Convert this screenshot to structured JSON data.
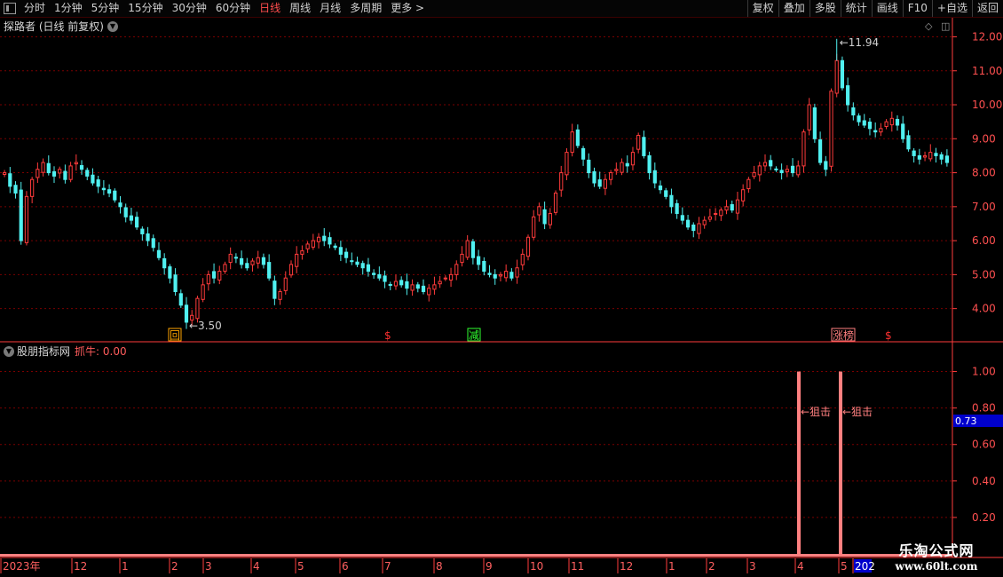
{
  "toolbar": {
    "periods": [
      "分时",
      "1分钟",
      "5分钟",
      "15分钟",
      "30分钟",
      "60分钟",
      "日线",
      "周线",
      "月线",
      "多周期",
      "更多 >"
    ],
    "active_period": "日线",
    "right": [
      "复权",
      "叠加",
      "多股",
      "统计",
      "画线",
      "F10",
      "+自选",
      "返回"
    ]
  },
  "main_chart": {
    "title": "探路者 (日线 前复权)",
    "high_label": "11.94",
    "low_label": "3.50",
    "markers": [
      "回",
      "$",
      "减",
      "涨榜",
      "$"
    ]
  },
  "indicator": {
    "name": "股朋指标网",
    "value_label": "抓牛: 0.00",
    "current_value_badge": "0.73",
    "signal_label": "狙击"
  },
  "watermark": {
    "line1": "乐淘公式网",
    "line2": "www.60lt.com"
  },
  "colors": {
    "up": "#ff3b3b",
    "down": "#50f0f0",
    "grid": "#7a0000",
    "axis": "#ff3b3b",
    "signal": "#ff8080",
    "badge": "#0000cc"
  },
  "chart_data": [
    {
      "type": "candlestick",
      "title": "探路者 (日线 前复权)",
      "y_ticks": [
        4.0,
        5.0,
        6.0,
        7.0,
        8.0,
        9.0,
        10.0,
        11.0,
        12.0
      ],
      "ylim": [
        3.05,
        12.3
      ],
      "x_labels": [
        "2023年",
        "12",
        "1",
        "2",
        "3",
        "4",
        "5",
        "6",
        "7",
        "8",
        "9",
        "10",
        "11",
        "12",
        "1",
        "2",
        "3",
        "4",
        "5",
        "202"
      ],
      "annotations": [
        {
          "text": "11.94",
          "type": "high"
        },
        {
          "text": "3.50",
          "type": "low"
        }
      ],
      "close_series": [
        8.0,
        7.6,
        7.4,
        6.0,
        7.3,
        7.8,
        8.1,
        8.3,
        8.0,
        7.9,
        8.1,
        7.8,
        8.2,
        8.3,
        8.1,
        7.9,
        7.7,
        7.6,
        7.5,
        7.4,
        7.2,
        7.0,
        6.7,
        6.6,
        6.4,
        6.2,
        6.0,
        5.8,
        5.5,
        5.2,
        4.9,
        4.5,
        4.1,
        3.6,
        3.8,
        4.3,
        4.7,
        5.0,
        4.9,
        5.1,
        5.3,
        5.6,
        5.5,
        5.3,
        5.2,
        5.4,
        5.5,
        5.3,
        4.9,
        4.3,
        4.5,
        4.9,
        5.3,
        5.6,
        5.7,
        5.9,
        6.0,
        6.1,
        6.0,
        5.9,
        5.8,
        5.6,
        5.5,
        5.4,
        5.3,
        5.2,
        5.1,
        5.0,
        4.9,
        4.8,
        4.7,
        4.8,
        4.7,
        4.6,
        4.7,
        4.6,
        4.5,
        4.6,
        4.7,
        4.8,
        4.9,
        5.0,
        5.3,
        5.6,
        6.0,
        5.5,
        5.3,
        5.1,
        5.0,
        4.9,
        5.0,
        5.1,
        4.9,
        5.2,
        5.6,
        6.1,
        6.7,
        7.0,
        6.5,
        6.8,
        7.4,
        8.0,
        8.6,
        9.2,
        8.8,
        8.4,
        8.0,
        7.7,
        7.6,
        7.8,
        8.0,
        8.1,
        8.3,
        8.2,
        8.6,
        9.1,
        8.5,
        8.0,
        7.7,
        7.5,
        7.3,
        7.0,
        6.8,
        6.6,
        6.4,
        6.3,
        6.5,
        6.6,
        6.7,
        6.8,
        6.9,
        7.0,
        6.9,
        7.2,
        7.5,
        7.8,
        8.0,
        8.2,
        8.3,
        8.2,
        8.1,
        8.0,
        8.1,
        8.0,
        8.2,
        9.2,
        10.0,
        9.0,
        8.3,
        8.1,
        10.4,
        11.3,
        10.5,
        10.0,
        9.7,
        9.5,
        9.4,
        9.3,
        9.2,
        9.3,
        9.5,
        9.6,
        9.4,
        9.0,
        8.7,
        8.5,
        8.4,
        8.5,
        8.6,
        8.5,
        8.4,
        8.3
      ]
    },
    {
      "type": "bar",
      "title": "股朋指标网",
      "series_label": "抓牛",
      "y_ticks": [
        0.2,
        0.4,
        0.6,
        0.8,
        1.0
      ],
      "ylim": [
        0.0,
        1.1
      ],
      "signals": [
        {
          "month": "4",
          "value": 1.0,
          "label": "狙击"
        },
        {
          "month": "5",
          "value": 1.0,
          "label": "狙击"
        }
      ]
    }
  ]
}
